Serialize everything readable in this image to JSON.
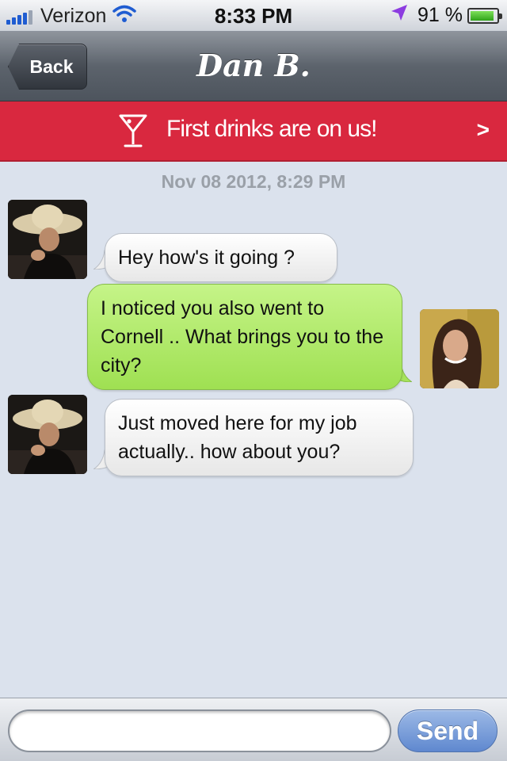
{
  "status_bar": {
    "carrier": "Verizon",
    "time": "8:33 PM",
    "battery": "91 %",
    "battery_level": 0.91,
    "icons": [
      "signal-icon",
      "wifi-icon",
      "location-icon",
      "battery-icon"
    ]
  },
  "nav": {
    "back_label": "Back",
    "title": "Dan B."
  },
  "promo": {
    "text": "First drinks are on us!",
    "chevron": ">",
    "icon": "cocktail-glass-icon",
    "color": "#d9283f"
  },
  "conversation": {
    "timestamp": "Nov 08 2012, 8:29 PM",
    "messages": [
      {
        "from": "them",
        "text": "Hey how's it going ?"
      },
      {
        "from": "me",
        "text": "I noticed you also went to Cornell .. What brings you to the city?"
      },
      {
        "from": "them",
        "text": "Just moved here for my job actually.. how about you?"
      }
    ]
  },
  "composer": {
    "placeholder": "",
    "value": "",
    "send_label": "Send"
  },
  "colors": {
    "background": "#dbe2ed",
    "incoming_bubble": "#ffffff",
    "outgoing_bubble": "#b2e86c",
    "send_button": "#6f95d6"
  }
}
